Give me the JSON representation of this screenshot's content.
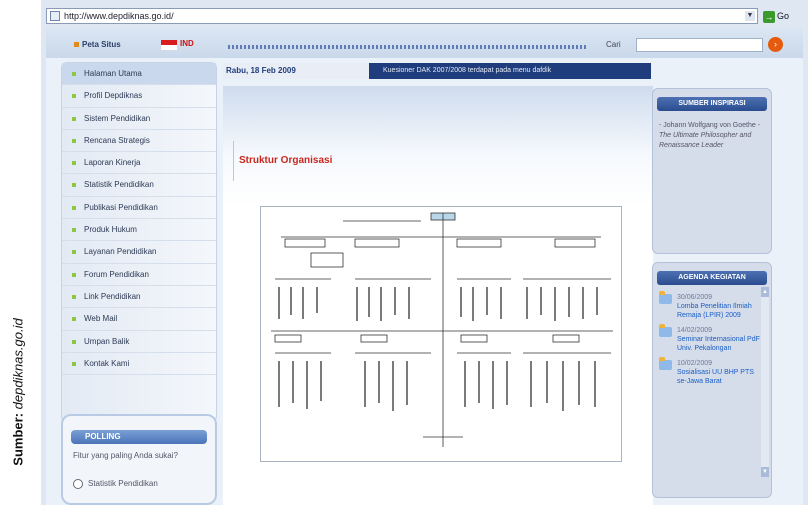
{
  "source_caption": {
    "label": "Sumber:",
    "value": "depdiknas.go.id"
  },
  "browser": {
    "url": "http://www.depdiknas.go.id/",
    "go_label": "Go"
  },
  "header": {
    "site_map": "Peta Situs",
    "language": "IND",
    "search_label": "Cari",
    "search_placeholder": ""
  },
  "nav": {
    "items": [
      {
        "label": "Halaman Utama"
      },
      {
        "label": "Profil Depdiknas"
      },
      {
        "label": "Sistem Pendidikan"
      },
      {
        "label": "Rencana Strategis"
      },
      {
        "label": "Laporan Kinerja"
      },
      {
        "label": "Statistik Pendidikan"
      },
      {
        "label": "Publikasi Pendidikan"
      },
      {
        "label": "Produk Hukum"
      },
      {
        "label": "Layanan Pendidikan"
      },
      {
        "label": "Forum Pendidikan"
      },
      {
        "label": "Link Pendidikan"
      },
      {
        "label": "Web Mail"
      },
      {
        "label": "Umpan Balik"
      },
      {
        "label": "Kontak Kami"
      }
    ]
  },
  "polling": {
    "title": "POLLING",
    "question": "Fitur yang paling Anda sukai?",
    "option": "Statistik Pendidikan"
  },
  "date_bar": {
    "date": "Rabu, 18 Feb 2009",
    "ticker": "Kuesioner DAK 2007/2008 terdapat pada menu dafdik"
  },
  "content": {
    "title": "Struktur Organisasi"
  },
  "inspirasi": {
    "title": "SUMBER INSPIRASI",
    "author": "- Johann Wolfgang von Goethe -",
    "book": "The Ultimate Philosopher and Renaissance Leader"
  },
  "agenda": {
    "title": "AGENDA KEGIATAN",
    "items": [
      {
        "date": "30/06/2009",
        "title": "Lomba Penelitian Ilmiah Remaja (LPIR) 2009"
      },
      {
        "date": "14/02/2009",
        "title": "Seminar Internasional PdF Univ. Pekalongan"
      },
      {
        "date": "10/02/2009",
        "title": "Sosialisasi UU BHP PTS se-Jawa Barat"
      }
    ]
  },
  "colors": {
    "accent": "#1f3c7c",
    "title_red": "#c8261d",
    "bullet_green": "#8dc63f"
  }
}
